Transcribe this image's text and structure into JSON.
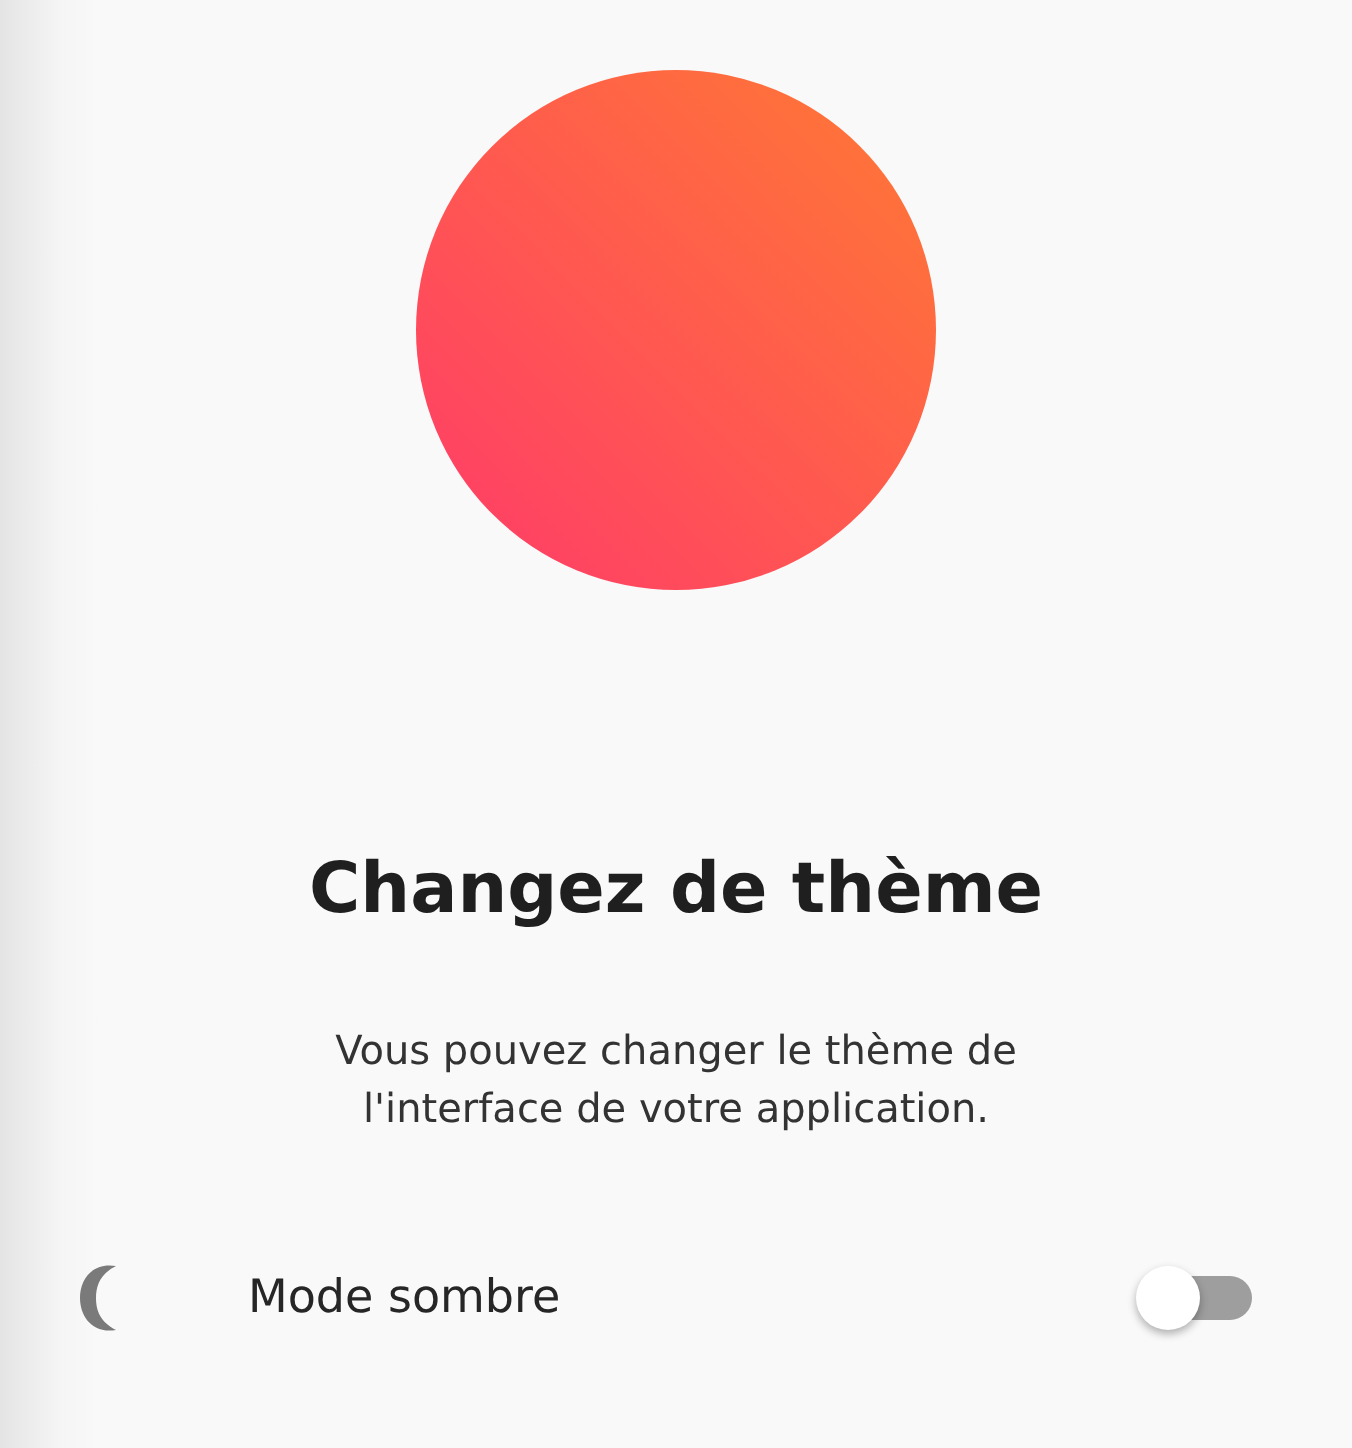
{
  "title": "Changez de thème",
  "description": "Vous pouvez changer le thème de l'interface de votre application.",
  "setting": {
    "label": "Mode sombre",
    "on": false
  }
}
